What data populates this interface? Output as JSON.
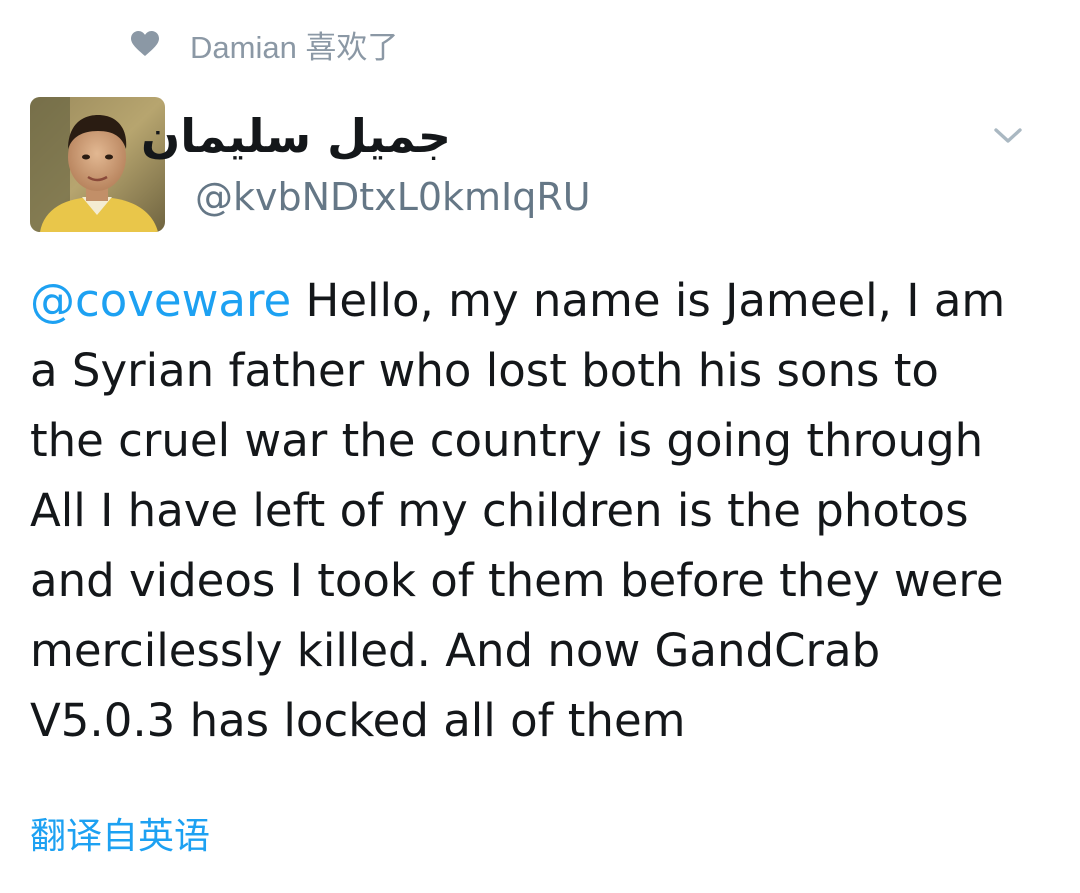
{
  "context": {
    "icon": "heart-icon",
    "text": "Damian 喜欢了"
  },
  "author": {
    "avatar": "avatar-photo",
    "display_name": "جميل سليمان",
    "handle": "@kvbNDtxL0kmIqRU"
  },
  "menu": {
    "icon": "chevron-down-icon"
  },
  "tweet": {
    "mention": "@coveware",
    "lines": [
      " Hello, my name is Jameel, I am",
      "a Syrian father who lost both his sons to",
      "the cruel war the country is going through",
      "All I have left of my children is the photos",
      "and videos I took of them before they were",
      "mercilessly killed. And now GandCrab",
      "V5.0.3 has locked all of them"
    ]
  },
  "translate": {
    "label": "翻译自英语"
  },
  "colors": {
    "link": "#1da1f2",
    "muted": "#8b98a5",
    "text": "#14171a"
  }
}
